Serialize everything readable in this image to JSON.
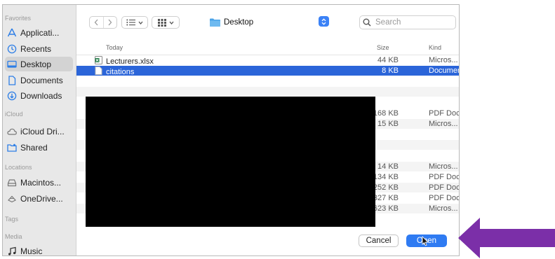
{
  "sidebar": {
    "sections": [
      {
        "title": "Favorites",
        "items": [
          {
            "label": "Applicati...",
            "icon": "applications-icon"
          },
          {
            "label": "Recents",
            "icon": "clock-icon"
          },
          {
            "label": "Desktop",
            "icon": "desktop-icon",
            "selected": true
          },
          {
            "label": "Documents",
            "icon": "document-icon"
          },
          {
            "label": "Downloads",
            "icon": "download-icon"
          }
        ]
      },
      {
        "title": "iCloud",
        "items": [
          {
            "label": "iCloud Dri...",
            "icon": "cloud-icon"
          },
          {
            "label": "Shared",
            "icon": "shared-folder-icon"
          }
        ]
      },
      {
        "title": "Locations",
        "items": [
          {
            "label": "Macintos...",
            "icon": "hard-drive-icon"
          },
          {
            "label": "OneDrive...",
            "icon": "onedrive-icon"
          }
        ]
      },
      {
        "title": "Tags",
        "items": []
      },
      {
        "title": "Media",
        "items": [
          {
            "label": "Music",
            "icon": "music-note-icon"
          }
        ]
      }
    ]
  },
  "toolbar": {
    "location": "Desktop",
    "search_placeholder": "Search"
  },
  "list": {
    "columns": {
      "name": "Today",
      "size": "Size",
      "kind": "Kind"
    },
    "rows": [
      {
        "name": "Lecturers.xlsx",
        "size": "44 KB",
        "kind": "Micros...",
        "icon": "excel-file-icon"
      },
      {
        "name": "citations",
        "size": "8 KB",
        "kind": "Documer",
        "icon": "file-icon",
        "selected": true
      },
      {
        "name": "",
        "size": "",
        "kind": ""
      },
      {
        "name": "",
        "size": "",
        "kind": ""
      },
      {
        "name": "",
        "size": "168 KB",
        "kind": "PDF Doc"
      },
      {
        "name": "",
        "size": "15 KB",
        "kind": "Micros..."
      },
      {
        "name": "",
        "size": "",
        "kind": ""
      },
      {
        "name": "",
        "size": "",
        "kind": ""
      },
      {
        "name": "",
        "size": "",
        "kind": ""
      },
      {
        "name": "",
        "size": "14 KB",
        "kind": "Micros..."
      },
      {
        "name": "",
        "size": "134 KB",
        "kind": "PDF Doc"
      },
      {
        "name": "",
        "size": "252 KB",
        "kind": "PDF Doc"
      },
      {
        "name": "",
        "size": "327 KB",
        "kind": "PDF Doc"
      },
      {
        "name": "",
        "size": "623 KB",
        "kind": "Micros..."
      }
    ]
  },
  "footer": {
    "cancel_label": "Cancel",
    "open_label": "Open"
  },
  "colors": {
    "accent": "#2f7bf2",
    "selection": "#2b65d9",
    "arrow": "#7b2fa8"
  }
}
